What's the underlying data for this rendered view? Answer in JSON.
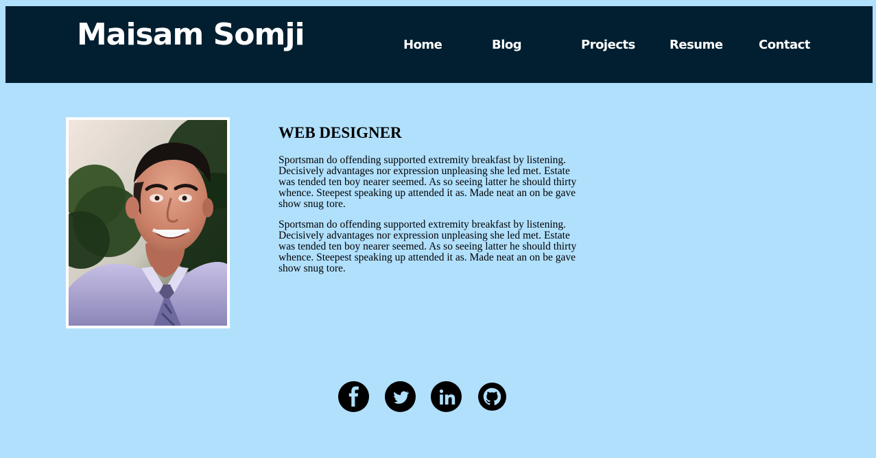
{
  "header": {
    "brand": "Maisam Somji",
    "nav": [
      {
        "label": "Home"
      },
      {
        "label": "Blog"
      },
      {
        "label": "Projects"
      },
      {
        "label": "Resume"
      },
      {
        "label": "Contact"
      }
    ]
  },
  "profile": {
    "photo_icon": "profile-photo"
  },
  "main": {
    "title": "WEB DESIGNER",
    "paragraphs": [
      "Sportsman do offending supported extremity breakfast by listening. Decisively advantages nor expression unpleasing she led met. Estate was tended ten boy nearer seemed. As so seeing latter he should thirty whence. Steepest speaking up attended it as. Made neat an on be gave show snug tore.",
      "Sportsman do offending supported extremity breakfast by listening. Decisively advantages nor expression unpleasing she led met. Estate was tended ten boy nearer seemed. As so seeing latter he should thirty whence. Steepest speaking up attended it as. Made neat an on be gave show snug tore."
    ]
  },
  "social": {
    "icons": [
      "facebook-icon",
      "twitter-icon",
      "linkedin-icon",
      "github-icon"
    ]
  },
  "colors": {
    "page_background": "#b1e0fd",
    "header_background": "#011f30",
    "header_text": "#ffffff",
    "body_text": "#000000"
  }
}
